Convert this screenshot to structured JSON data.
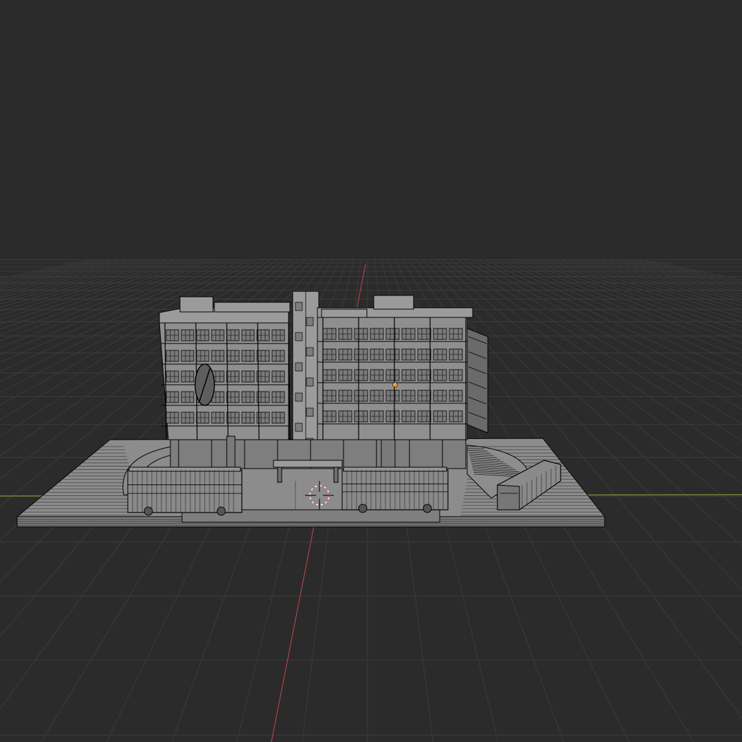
{
  "viewport": {
    "kind": "3d-viewport",
    "shading": "wireframe",
    "background_color": "#2b2b2b",
    "grid_color": "#3c3c3c",
    "x_axis_color": "#7d9a3c",
    "y_axis_color": "#b3424a",
    "wire_color": "#000000",
    "surface_color": "#8f8f8f",
    "origin_color": "#f29d38",
    "cursor_color": "#e35b5b"
  },
  "scene": {
    "objects": [
      "building",
      "plaza-base",
      "bus-left",
      "bus-center",
      "bus-right",
      "stairway",
      "canopy"
    ]
  },
  "icons": {
    "origin": "origin-dot-icon",
    "cursor": "3d-cursor-icon"
  }
}
